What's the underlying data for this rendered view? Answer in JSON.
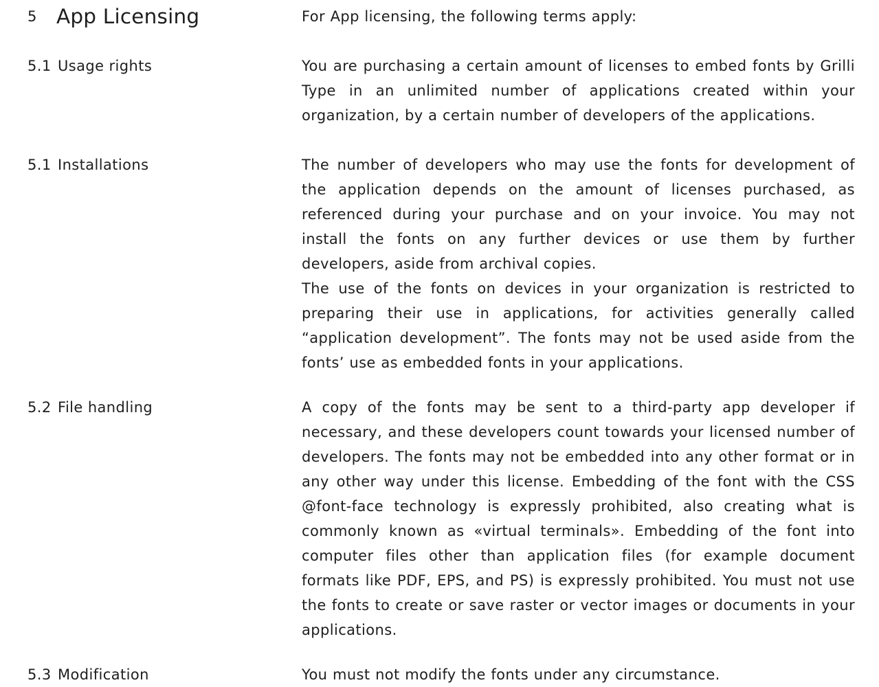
{
  "section": {
    "number": "5",
    "title": "App Licensing",
    "intro": "For App licensing, the following terms apply:"
  },
  "clauses": [
    {
      "number": "5.1",
      "label": "Usage rights",
      "paragraphs": [
        "You are purchasing a certain amount of licenses to embed fonts by Grilli Type in an unlimited number of applications created within your organization, by a certain number of developers of the applications."
      ]
    },
    {
      "number": "5.1",
      "label": "Installations",
      "paragraphs": [
        "The number of developers who may use the fonts for development of the application depends on the amount of licenses purchased, as referenced during your purchase and on your invoice. You may not install the fonts on any further devices or use them by further developers, aside from archival copies.",
        "The use of the fonts on devices in your organization is restricted to preparing their use in applications, for activities generally called “application development”. The fonts may not be used aside from the fonts’ use as embedded fonts in your applications."
      ]
    },
    {
      "number": "5.2",
      "label": "File handling",
      "paragraphs": [
        "A copy of the fonts may be sent to a third-party app developer if necessary, and these developers count towards your licensed number of developers. The fonts may not be embedded into any other format or in any other way under this license. Embedding of the font with the CSS @font-face technology is expressly prohibited, also creating what is commonly known as «virtual terminals». Embedding of the font into computer files other than application files (for example document formats like PDF, EPS, and PS) is expressly prohibited. You must not use the fonts to create or save raster or vector images or documents in your applications."
      ]
    },
    {
      "number": "5.3",
      "label": "Modification",
      "paragraphs": [
        "You must not modify the fonts under any circumstance."
      ]
    }
  ]
}
